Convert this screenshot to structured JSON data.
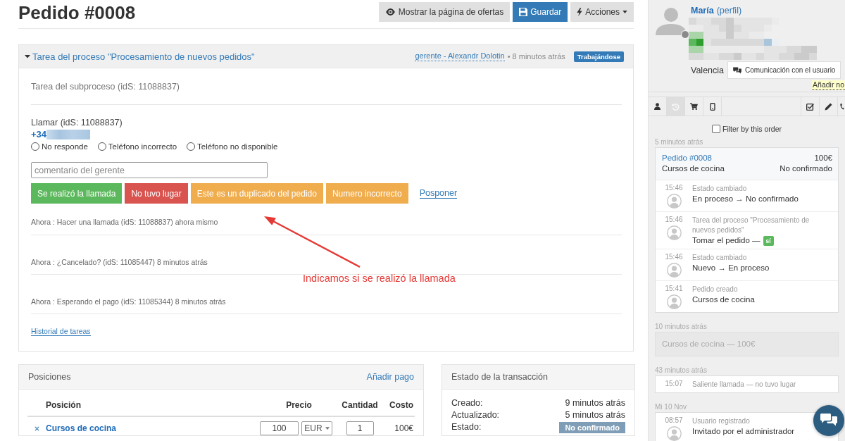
{
  "header": {
    "title": "Pedido #0008",
    "buttons": [
      {
        "label": "Mostrar la página de ofertas",
        "kind": "preview"
      },
      {
        "label": "Guardar",
        "kind": "save"
      },
      {
        "label": "Acciones",
        "kind": "menu"
      }
    ]
  },
  "task": {
    "expanded": true,
    "title": "Tarea del proceso \"Procesamiento de nuevos pedidos\"",
    "assignee": "gerente - Alexandr Dolotin",
    "time": "• 8 minutos atrás",
    "status": "Trabajándose",
    "subprocess": "Tarea del subproceso (idS: 11088837)",
    "call": {
      "title": "Llamar (idS: 11088837)",
      "phone": "+34",
      "options": [
        {
          "label": "No responde",
          "selected": false
        },
        {
          "label": "Teléfono incorrecto",
          "selected": false
        },
        {
          "label": "Teléfono no disponible",
          "selected": false
        }
      ],
      "comment": {
        "placeholder": "comentario del gerente"
      },
      "actions": [
        {
          "label": "Se realizó la llamada",
          "kind": "success"
        },
        {
          "label": "No tuvo lugar",
          "kind": "danger"
        },
        {
          "label": "Este es un duplicado del pedido",
          "kind": "warning"
        },
        {
          "label": "Numero incorrecto",
          "kind": "warning"
        },
        {
          "label": "Posponer",
          "kind": "link"
        }
      ]
    },
    "history": [
      "Ahora : Hacer una llamada (idS: 11088837) ahora mismo",
      "Ahora : ¿Cancelado? (idS: 11085447) 8 minutos atrás",
      "Ahora : Esperando el pago (idS: 11085344) 8 minutos atrás"
    ],
    "history_link": "Historial de tareas"
  },
  "annotation": {
    "text": "Indicamos si se realizó la llamada"
  },
  "positions": {
    "title": "Posiciones",
    "add_link": "Añadir pago",
    "columns": [
      "Posición",
      "Precio",
      "Cantidad",
      "Costo"
    ],
    "rows": [
      {
        "name": "Cursos de cocina",
        "price": "100",
        "currency": "EUR",
        "quantity": "1",
        "cost": "100€"
      }
    ]
  },
  "transaction": {
    "title": "Estado de la transacción",
    "rows": [
      {
        "label": "Creado:",
        "value": "9 minutos atrás",
        "kind": "text"
      },
      {
        "label": "Actualizado:",
        "value": "5 minutos atrás",
        "kind": "text"
      },
      {
        "label": "Estado:",
        "value": "No confirmado",
        "kind": "badge"
      }
    ]
  },
  "sidebar": {
    "user": {
      "name": "María",
      "profile_link": "(perfil)",
      "online": false,
      "city": "Valencia",
      "contact_button": "Comunicación con el usuario",
      "add_note": "Añadir no"
    },
    "tabs_left": [
      {
        "selected": false
      },
      {
        "selected": true
      },
      {
        "selected": false
      },
      {
        "selected": false
      }
    ],
    "tabs_right": [
      {
        "selected": false
      },
      {
        "selected": false
      },
      {
        "selected": false
      }
    ],
    "filter": {
      "label": "Filter by this order",
      "checked": false
    },
    "feed": [
      {
        "date": "5 minutos atrás",
        "kind": "order",
        "order": {
          "number": "Pedido #0008",
          "total": "100€",
          "product": "Cursos de cocina",
          "status": "No confirmado"
        },
        "entries": [
          {
            "time": "15:46",
            "title": "Estado cambiado",
            "body": "En proceso → No confirmado"
          },
          {
            "time": "15:46",
            "title": "Tarea del proceso \"Procesamiento de nuevos pedidos\"",
            "body": "Tomar el pedido —",
            "badge": "sí"
          },
          {
            "time": "15:46",
            "title": "Estado cambiado",
            "body": "Nuevo → En proceso"
          },
          {
            "time": "15:41",
            "title": "Pedido creado",
            "body": "Cursos de cocina"
          }
        ]
      },
      {
        "date": "10 minutos atrás",
        "kind": "muted",
        "text": "Cursos de cocina — 100€"
      },
      {
        "date": "43 minutos atrás",
        "kind": "list",
        "entries": [
          {
            "time": "15:07",
            "title": "Saliente llamada — no tuvo lugar"
          }
        ]
      },
      {
        "date": "Mi 10 Nov",
        "kind": "list",
        "entries": [
          {
            "time": "08:57",
            "title": "Usuario registrado",
            "body": "Invitado por el administrador"
          }
        ]
      }
    ]
  }
}
